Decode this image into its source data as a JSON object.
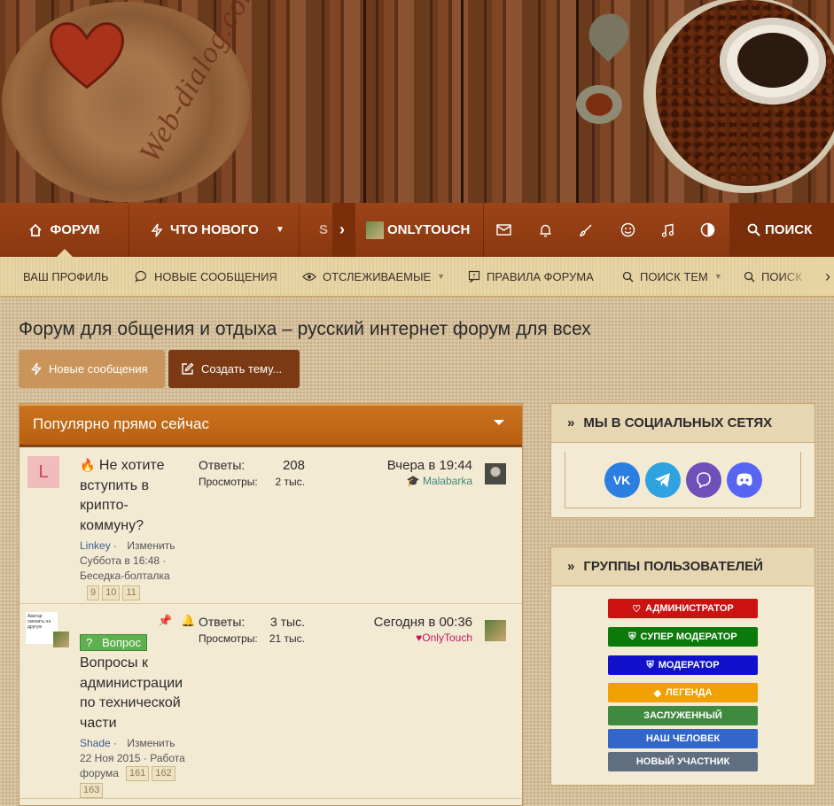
{
  "banner": {
    "logo_text": "Web-dialog.com"
  },
  "main_nav": {
    "items": [
      {
        "label": "ФОРУМ",
        "icon": "home-icon"
      },
      {
        "label": "ЧТО НОВОГО",
        "icon": "lightning-icon"
      },
      {
        "label": "ONLYTOUCH",
        "icon": "user-avatar"
      }
    ],
    "search_label": "ПОИСК"
  },
  "sub_nav": {
    "items": [
      {
        "label": "ВАШ ПРОФИЛЬ"
      },
      {
        "label": "НОВЫЕ СООБЩЕНИЯ"
      },
      {
        "label": "ОТСЛЕЖИВАЕМЫЕ"
      },
      {
        "label": "ПРАВИЛА ФОРУМА"
      },
      {
        "label": "ПОИСК ТЕМ"
      },
      {
        "label": "ПОИСК"
      }
    ]
  },
  "page": {
    "title": "Форум для общения и отдыха – русский интернет форум для всех"
  },
  "buttons": {
    "new_messages": "Новые сообщения",
    "create_thread": "Создать тему..."
  },
  "popular": {
    "title": "Популярно прямо сейчас",
    "threads": [
      {
        "avatar_letter": "L",
        "title": "Не хотите вступить в крипто-коммуну?",
        "author": "Linkey",
        "edit": "Изменить",
        "date": "Суббота в 16:48",
        "forum": "Беседка-болталка",
        "pages": [
          "9",
          "10",
          "11"
        ],
        "replies_label": "Ответы:",
        "replies": "208",
        "views_label": "Просмотры:",
        "views": "2 тыс.",
        "last_date": "Вчера в 19:44",
        "last_user": "Malabarka"
      },
      {
        "avatar_caption": "Аватар сменить на другую",
        "prefix": "Вопрос",
        "title": "Вопросы к администрации по технической части",
        "author": "Shade",
        "edit": "Изменить",
        "date": "22 Ноя 2015",
        "forum": "Работа форума",
        "pages": [
          "161",
          "162",
          "163"
        ],
        "replies_label": "Ответы:",
        "replies": "3 тыс.",
        "views_label": "Просмотры:",
        "views": "21 тыс.",
        "last_date": "Сегодня в 00:36",
        "last_user": "OnlyTouch"
      }
    ]
  },
  "sidebar": {
    "social": {
      "title": "МЫ В СОЦИАЛЬНЫХ СЕТЯХ",
      "networks": [
        "VK",
        "Telegram",
        "Viber",
        "Discord"
      ]
    },
    "groups": {
      "title": "ГРУППЫ ПОЛЬЗОВАТЕЛЕЙ",
      "items": [
        {
          "label": "АДМИНИСТРАТОР",
          "color": "#cc1111"
        },
        {
          "label": "СУПЕР МОДЕРАТОР",
          "color": "#0a7a0a"
        },
        {
          "label": "МОДЕРАТОР",
          "color": "#1111cc"
        },
        {
          "label": "ЛЕГЕНДА",
          "color": "#f0a000"
        },
        {
          "label": "ЗАСЛУЖЕННЫЙ",
          "color": "#3f8a3f"
        },
        {
          "label": "НАШ ЧЕЛОВЕК",
          "color": "#3366cc"
        },
        {
          "label": "НОВЫЙ УЧАСТНИК",
          "color": "#5f6f80"
        }
      ]
    }
  }
}
